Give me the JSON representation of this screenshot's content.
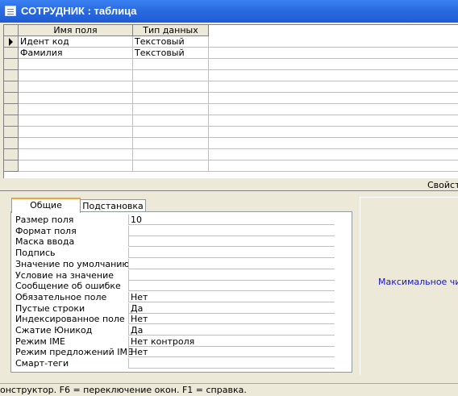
{
  "window": {
    "title": "СОТРУДНИК : таблица"
  },
  "grid": {
    "columns": [
      "Имя поля",
      "Тип данных"
    ],
    "rows": [
      {
        "name": "Идент код",
        "type": "Текстовый"
      },
      {
        "name": "Фамилия",
        "type": "Текстовый"
      }
    ]
  },
  "properties_label": "Свойств",
  "tabs": [
    "Общие",
    "Подстановка"
  ],
  "field_properties": [
    {
      "label": "Размер поля",
      "value": "10"
    },
    {
      "label": "Формат поля",
      "value": ""
    },
    {
      "label": "Маска ввода",
      "value": ""
    },
    {
      "label": "Подпись",
      "value": ""
    },
    {
      "label": "Значение по умолчанию",
      "value": ""
    },
    {
      "label": "Условие на значение",
      "value": ""
    },
    {
      "label": "Сообщение об ошибке",
      "value": ""
    },
    {
      "label": "Обязательное поле",
      "value": "Нет"
    },
    {
      "label": "Пустые строки",
      "value": "Да"
    },
    {
      "label": "Индексированное поле",
      "value": "Нет"
    },
    {
      "label": "Сжатие Юникод",
      "value": "Да"
    },
    {
      "label": "Режим IME",
      "value": "Нет контроля"
    },
    {
      "label": "Режим предложений IME",
      "value": "Нет"
    },
    {
      "label": "Смарт-теги",
      "value": ""
    }
  ],
  "help_text": "Максимальное числ",
  "status_bar": "онструктор.  F6 = переключение окон.  F1 = справка."
}
